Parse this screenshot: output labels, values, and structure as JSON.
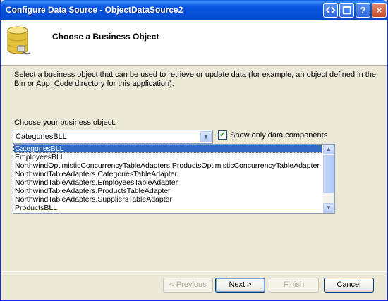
{
  "window": {
    "title": "Configure Data Source - ObjectDataSource2",
    "controls": [
      "?",
      "×"
    ]
  },
  "header": {
    "title": "Choose a Business Object",
    "icon": "database-plug-icon"
  },
  "description": "Select a business object that can be used to retrieve or update data (for example, an object defined in the Bin or App_Code directory for this application).",
  "business_object": {
    "label": "Choose your business object:",
    "selected": "CategoriesBLL",
    "show_only_label": "Show only data components",
    "show_only_checked": true,
    "options": [
      "CategoriesBLL",
      "EmployeesBLL",
      "NorthwindOptimisticConcurrencyTableAdapters.ProductsOptimisticConcurrencyTableAdapter",
      "NorthwindTableAdapters.CategoriesTableAdapter",
      "NorthwindTableAdapters.EmployeesTableAdapter",
      "NorthwindTableAdapters.ProductsTableAdapter",
      "NorthwindTableAdapters.SuppliersTableAdapter",
      "ProductsBLL"
    ]
  },
  "buttons": {
    "previous": "< Previous",
    "next": "Next >",
    "finish": "Finish",
    "cancel": "Cancel"
  },
  "colors": {
    "selection": "#316ac5",
    "titlebar": "#0450d8"
  }
}
